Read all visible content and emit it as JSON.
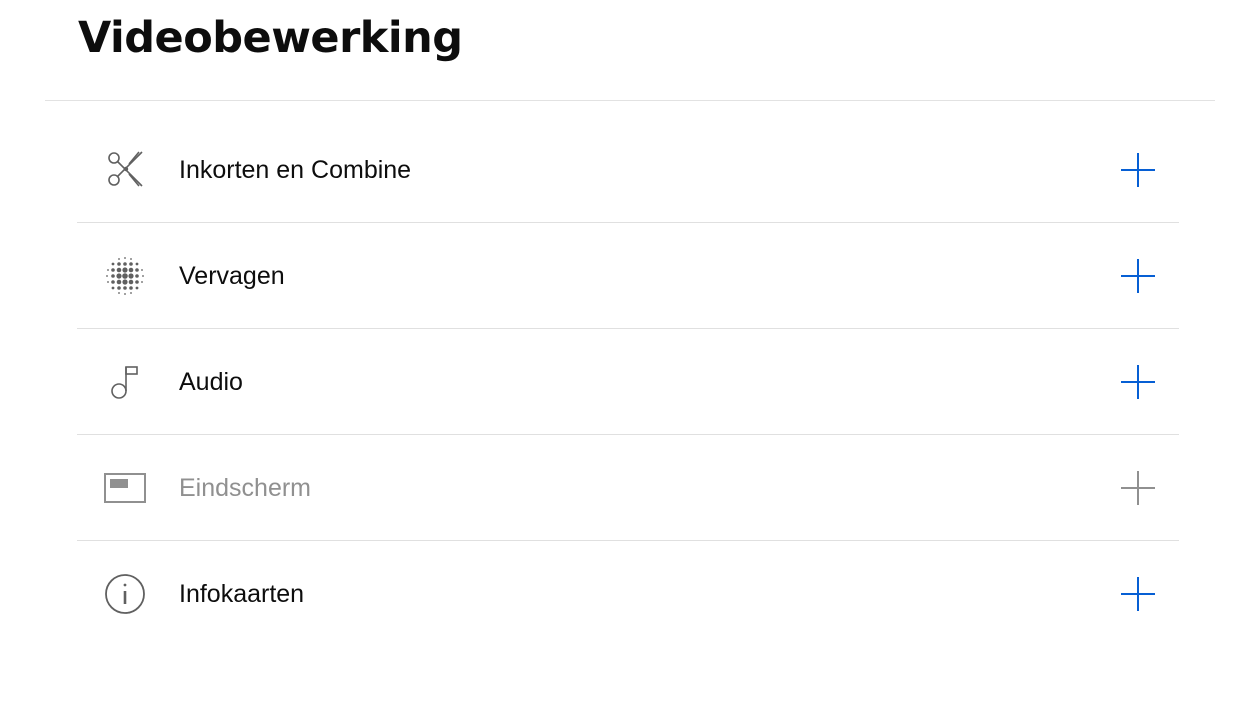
{
  "page": {
    "title": "Videobewerking"
  },
  "colors": {
    "accent": "#065fd4",
    "text": "#0d0d0d",
    "disabled": "#909090",
    "icon": "#606060",
    "divider": "#e0e0e0"
  },
  "tools": [
    {
      "label": "Inkorten en Combine",
      "icon": "scissors-icon",
      "enabled": true
    },
    {
      "label": "Vervagen",
      "icon": "blur-icon",
      "enabled": true
    },
    {
      "label": "Audio",
      "icon": "music-note-icon",
      "enabled": true
    },
    {
      "label": "Eindscherm",
      "icon": "end-screen-icon",
      "enabled": false
    },
    {
      "label": "Infokaarten",
      "icon": "info-icon",
      "enabled": true
    }
  ]
}
